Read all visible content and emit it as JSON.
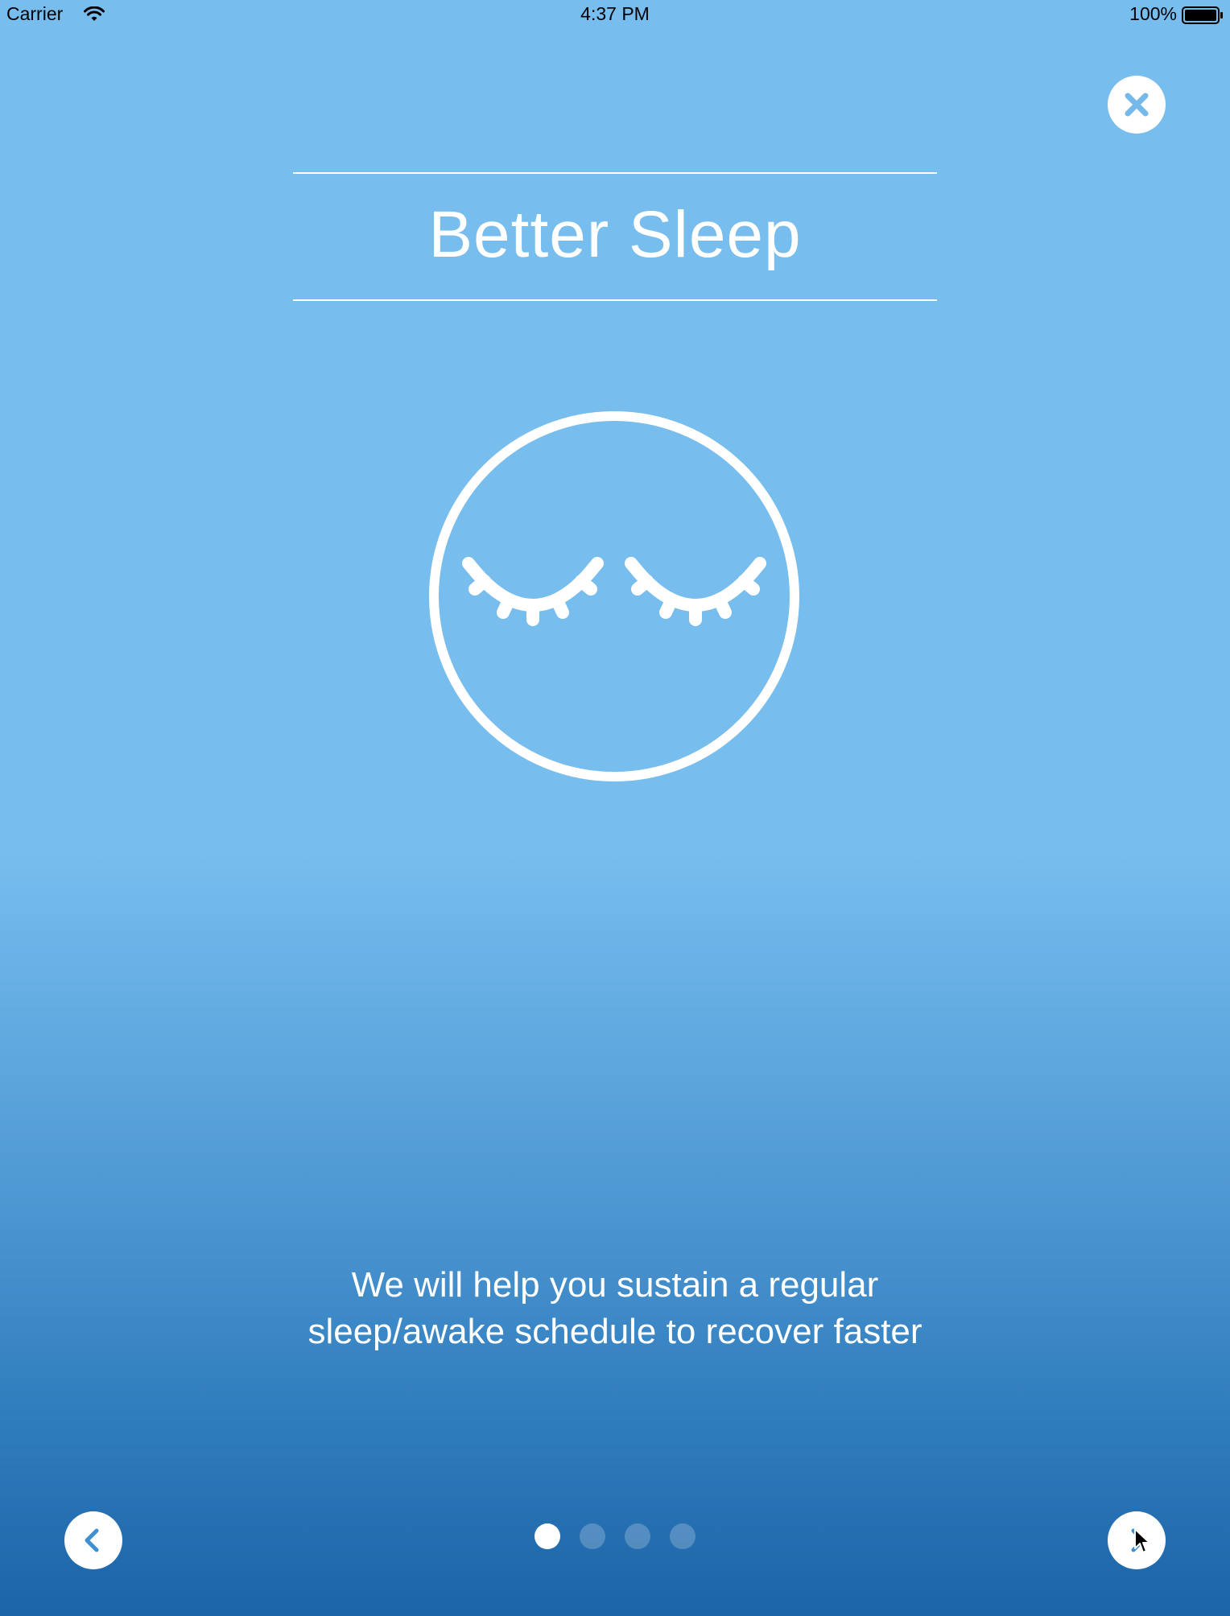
{
  "status_bar": {
    "carrier": "Carrier",
    "time": "4:37 PM",
    "battery": "100%"
  },
  "onboarding": {
    "title": "Better Sleep",
    "illustration_icon": "sleeping-face-icon",
    "description_line1": "We will help you sustain a regular",
    "description_line2": "sleep/awake schedule to recover faster",
    "page_count": 4,
    "current_page": 1
  },
  "controls": {
    "close_icon": "close-icon",
    "back_icon": "chevron-left-icon",
    "next_icon": "chevron-right-icon"
  },
  "colors": {
    "background_top": "#77bdee",
    "background_bottom": "#1c64a8",
    "accent": "#4a9ee0",
    "foreground": "#ffffff"
  }
}
